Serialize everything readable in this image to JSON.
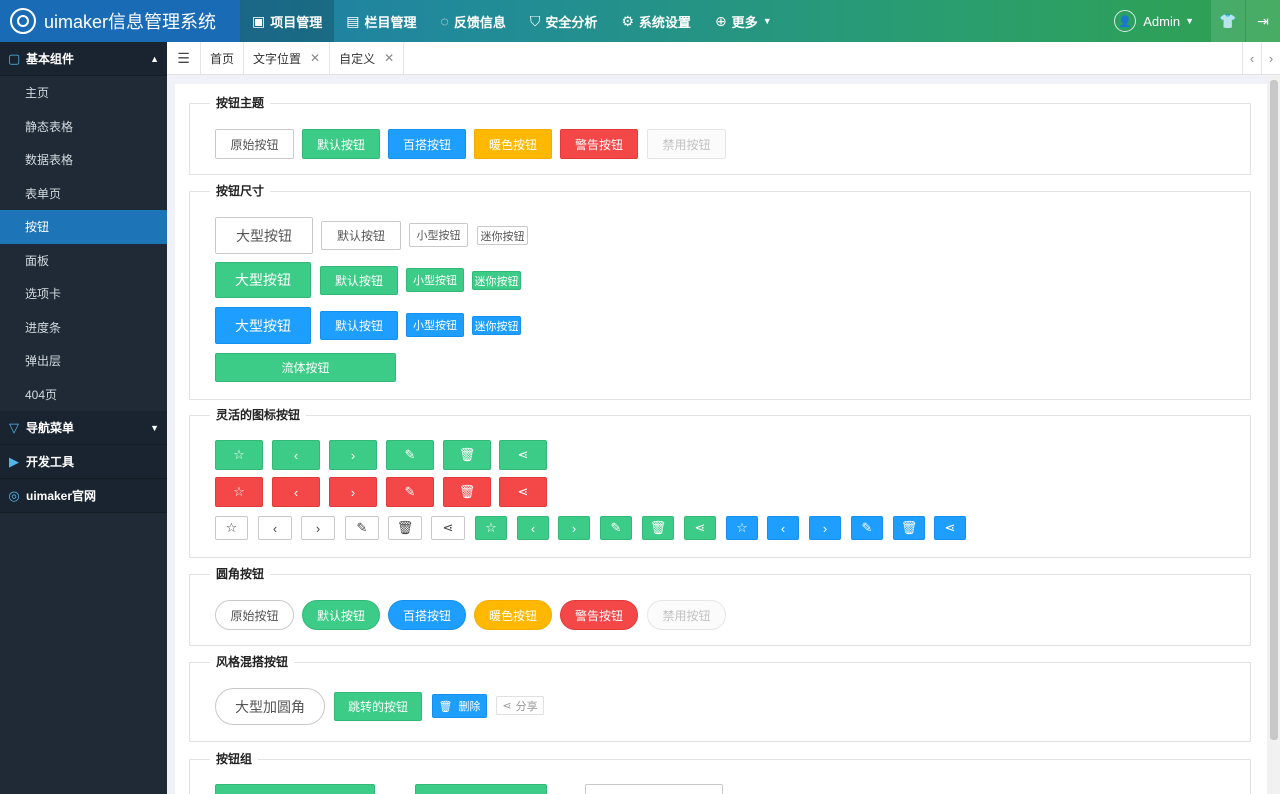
{
  "header": {
    "title": "uimaker信息管理系统",
    "nav": [
      {
        "label": "项目管理",
        "icon": "monitor-icon",
        "glyph": "▣"
      },
      {
        "label": "栏目管理",
        "icon": "list-icon",
        "glyph": "▤"
      },
      {
        "label": "反馈信息",
        "icon": "chat-icon",
        "glyph": "◌"
      },
      {
        "label": "安全分析",
        "icon": "shield-icon",
        "glyph": "⛉"
      },
      {
        "label": "系统设置",
        "icon": "gear-icon",
        "glyph": "⚙"
      },
      {
        "label": "更多",
        "icon": "plus-circle-icon",
        "glyph": "⊕"
      }
    ],
    "user": "Admin"
  },
  "sidebar": {
    "groups": [
      {
        "label": "基本组件",
        "icon": "clipboard-icon"
      },
      {
        "label": "导航菜单",
        "icon": "filter-icon"
      },
      {
        "label": "开发工具",
        "icon": "play-icon"
      },
      {
        "label": "uimaker官网",
        "icon": "logo-icon"
      }
    ],
    "items": [
      "主页",
      "静态表格",
      "数据表格",
      "表单页",
      "按钮",
      "面板",
      "选项卡",
      "进度条",
      "弹出层",
      "404页"
    ]
  },
  "tabs": [
    {
      "label": "首页"
    },
    {
      "label": "文字位置"
    },
    {
      "label": "自定义"
    }
  ],
  "sections": {
    "themes": {
      "title": "按钮主题",
      "buttons": [
        "原始按钮",
        "默认按钮",
        "百搭按钮",
        "暖色按钮",
        "警告按钮",
        "禁用按钮"
      ]
    },
    "sizes": {
      "title": "按钮尺寸",
      "large": "大型按钮",
      "default": "默认按钮",
      "small": "小型按钮",
      "mini": "迷你按钮",
      "fluid": "流体按钮"
    },
    "icons": {
      "title": "灵活的图标按钮"
    },
    "rounded": {
      "title": "圆角按钮",
      "buttons": [
        "原始按钮",
        "默认按钮",
        "百搭按钮",
        "暖色按钮",
        "警告按钮",
        "禁用按钮"
      ]
    },
    "mixed": {
      "title": "风格混搭按钮",
      "large_round": "大型加圆角",
      "jump": "跳转的按钮",
      "delete": "删除",
      "share": "分享"
    },
    "groups": {
      "title": "按钮组"
    }
  }
}
